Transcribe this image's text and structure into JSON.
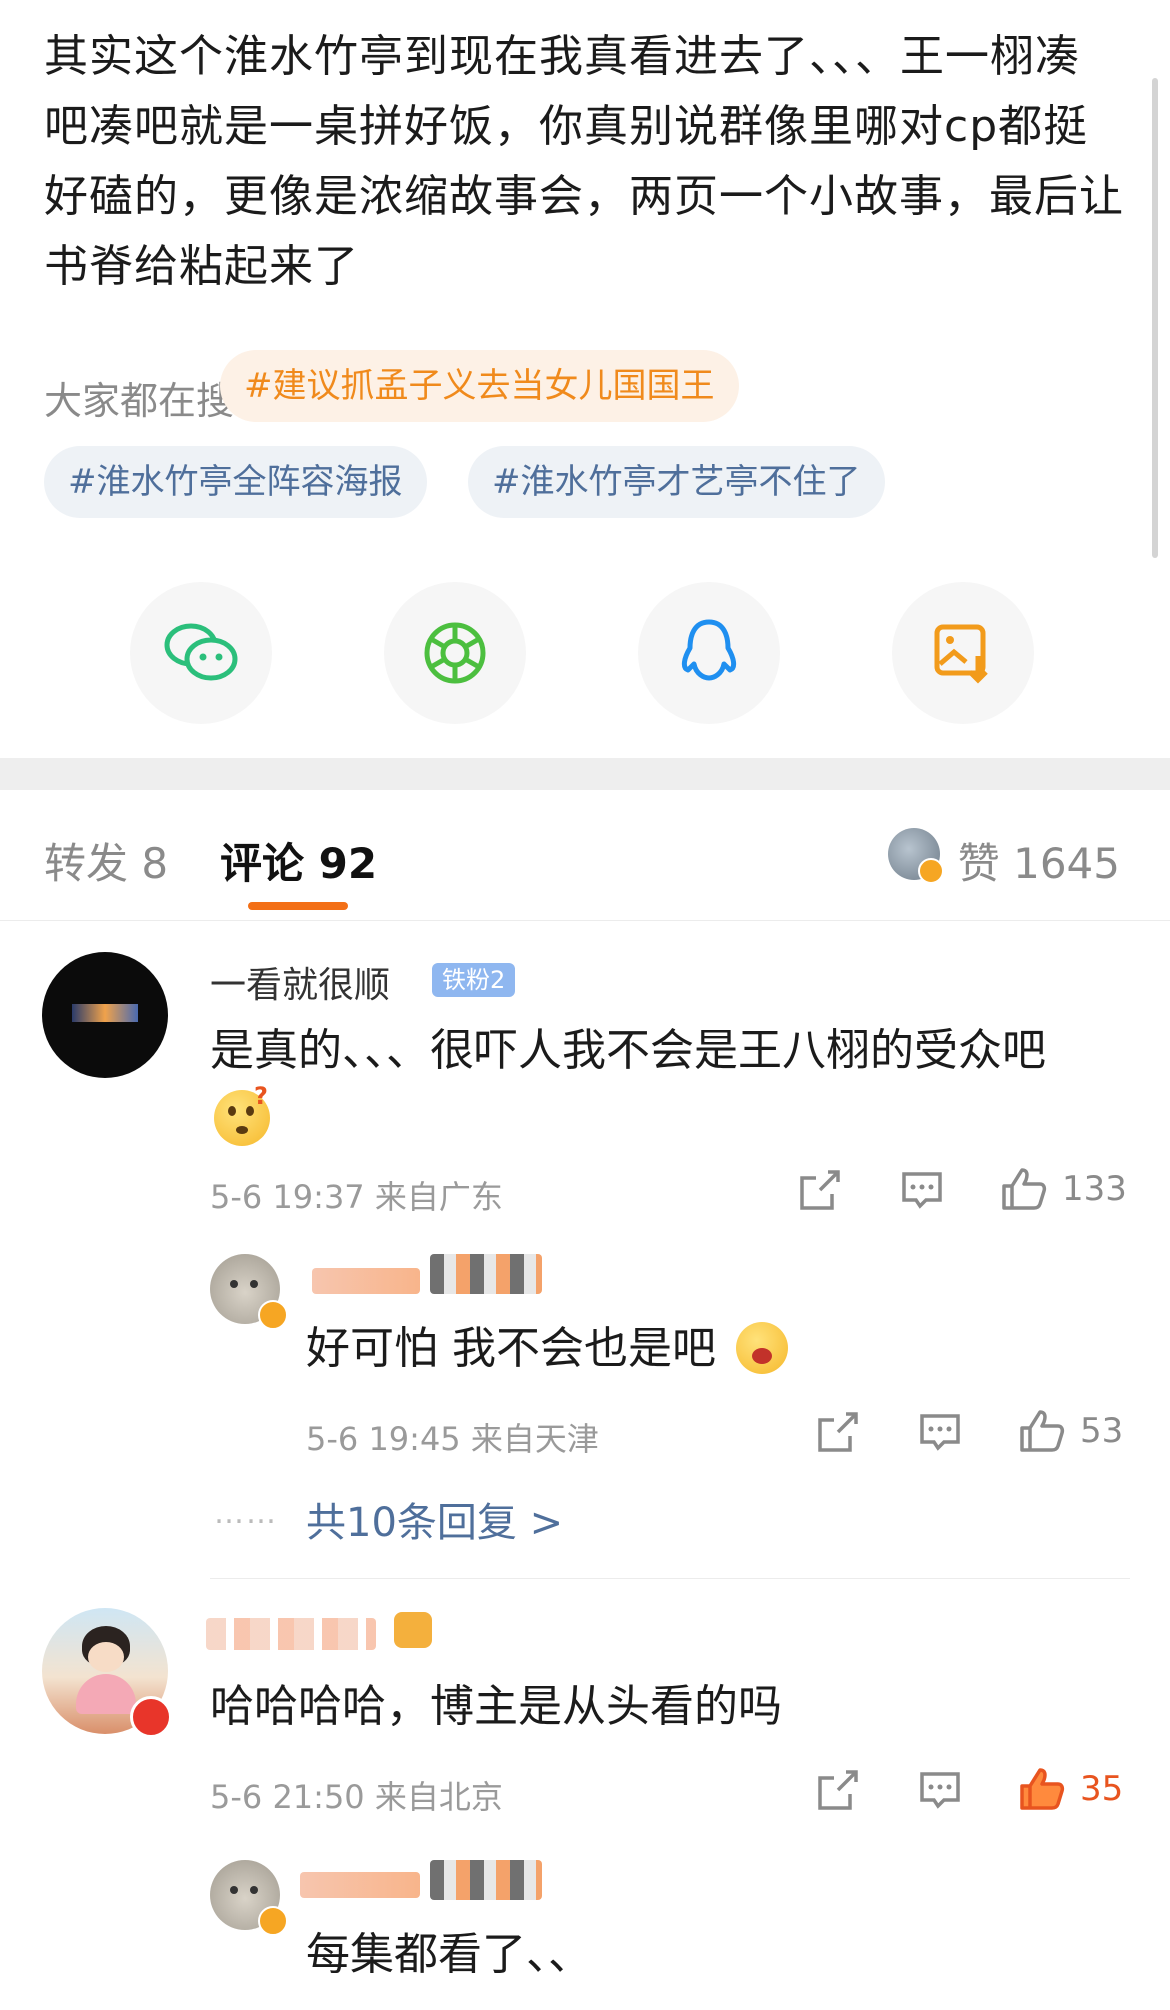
{
  "post": {
    "text": "其实这个淮水竹亭到现在我真看进去了、、、王一栩凑吧凑吧就是一桌拼好饭，你真别说群像里哪对cp都挺好磕的，更像是浓缩故事会，两页一个小故事，最后让书脊给粘起来了"
  },
  "search": {
    "label": "大家都在搜",
    "chips": [
      "#建议抓孟子义去当女儿国国王",
      "#淮水竹亭全阵容海报",
      "#淮水竹亭才艺亭不住了"
    ]
  },
  "share": {
    "icons": [
      "wechat-icon",
      "moments-icon",
      "qq-icon",
      "save-image-icon"
    ]
  },
  "tabs": {
    "repost": "转发 8",
    "comment": "评论 92",
    "likes": "赞 1645"
  },
  "comments": [
    {
      "name": "一看就很顺",
      "badge": "铁粉2",
      "text": "是真的、、、很吓人我不会是王八栩的受众吧",
      "time": "5-6 19:37 来自广东",
      "like_count": "133",
      "reply": {
        "text": "好可怕 我不会也是吧",
        "time": "5-6 19:45 来自天津",
        "like_count": "53"
      },
      "more_replies": "共10条回复 >",
      "dots": "……"
    },
    {
      "text": "哈哈哈哈，博主是从头看的吗",
      "time": "5-6 21:50 来自北京",
      "like_count": "35",
      "reply": {
        "text": "每集都看了、、"
      }
    }
  ],
  "colors": {
    "accent": "#f36f16",
    "topic": "#4f6f9b",
    "hot": "#f08a1c",
    "liked": "#e8541f"
  }
}
